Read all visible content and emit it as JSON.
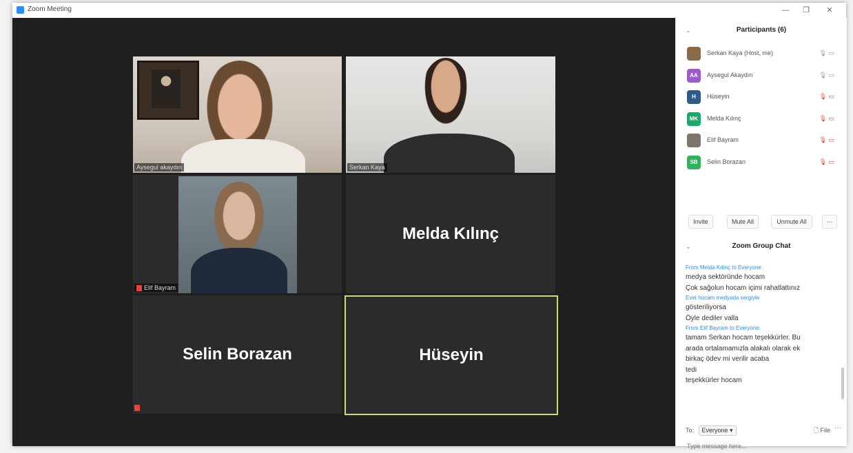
{
  "window": {
    "title": "Zoom Meeting",
    "minimize": "—",
    "maximize": "❐",
    "close": "✕"
  },
  "video_tiles": [
    {
      "name": "Aysegul akaydın",
      "type": "video"
    },
    {
      "name": "Serkan Kaya",
      "type": "video"
    },
    {
      "name": "Elif Bayram",
      "type": "video",
      "muted": true
    },
    {
      "name": "Melda Kılınç",
      "type": "name"
    },
    {
      "name": "Selin Borazan",
      "type": "name",
      "muted": true
    },
    {
      "name": "Hüseyin",
      "type": "name",
      "active": true
    }
  ],
  "participants": {
    "title": "Participants (6)",
    "list": [
      {
        "name": "Serkan Kaya (Host, me)",
        "avatar": "",
        "color": "#8a6a4a",
        "muted": false
      },
      {
        "name": "Aysegul Akaydın",
        "avatar": "AA",
        "color": "#9b59c9",
        "muted": false
      },
      {
        "name": "Hüseyin",
        "avatar": "H",
        "color": "#2f5a8a",
        "muted": true
      },
      {
        "name": "Melda Kılınç",
        "avatar": "MK",
        "color": "#18a96b",
        "muted": true
      },
      {
        "name": "Elif Bayram",
        "avatar": "",
        "color": "#7f756a",
        "muted": true
      },
      {
        "name": "Selin Borazan",
        "avatar": "SB",
        "color": "#2fb35b",
        "muted": true
      }
    ],
    "buttons": {
      "invite": "Invite",
      "mute_all": "Mute All",
      "unmute_all": "Unmute All",
      "more": "···"
    }
  },
  "chat": {
    "title": "Zoom Group Chat",
    "messages": [
      {
        "kind": "from",
        "text": "From Melda Kılınç to Everyone:"
      },
      {
        "kind": "msg",
        "text": "medya sektöründe hocam"
      },
      {
        "kind": "msg",
        "text": "Çok sağolun hocam içimi rahatlattınız"
      },
      {
        "kind": "from",
        "text": "Evet hocam medyada sergiyle"
      },
      {
        "kind": "msg",
        "text": "gösteriliyorsa"
      },
      {
        "kind": "msg",
        "text": "Öyle dediler valla"
      },
      {
        "kind": "from",
        "text": "From Elif Bayram to Everyone:"
      },
      {
        "kind": "msg",
        "text": "tamam Serkan hocam teşekkürler. Bu"
      },
      {
        "kind": "msg",
        "text": "arada ortalamamızla alakalı olarak ek"
      },
      {
        "kind": "msg",
        "text": "birkaç ödev mi verilir acaba"
      },
      {
        "kind": "msg",
        "text": "tedi"
      },
      {
        "kind": "msg",
        "text": "teşekkürler hocam"
      }
    ],
    "to_label": "To:",
    "to_value": "Everyone ▾",
    "file_label": "File",
    "more": "···",
    "placeholder": "Type message here..."
  },
  "icons": {
    "mic": "🎙",
    "cam": "📷",
    "file": "🗋"
  }
}
